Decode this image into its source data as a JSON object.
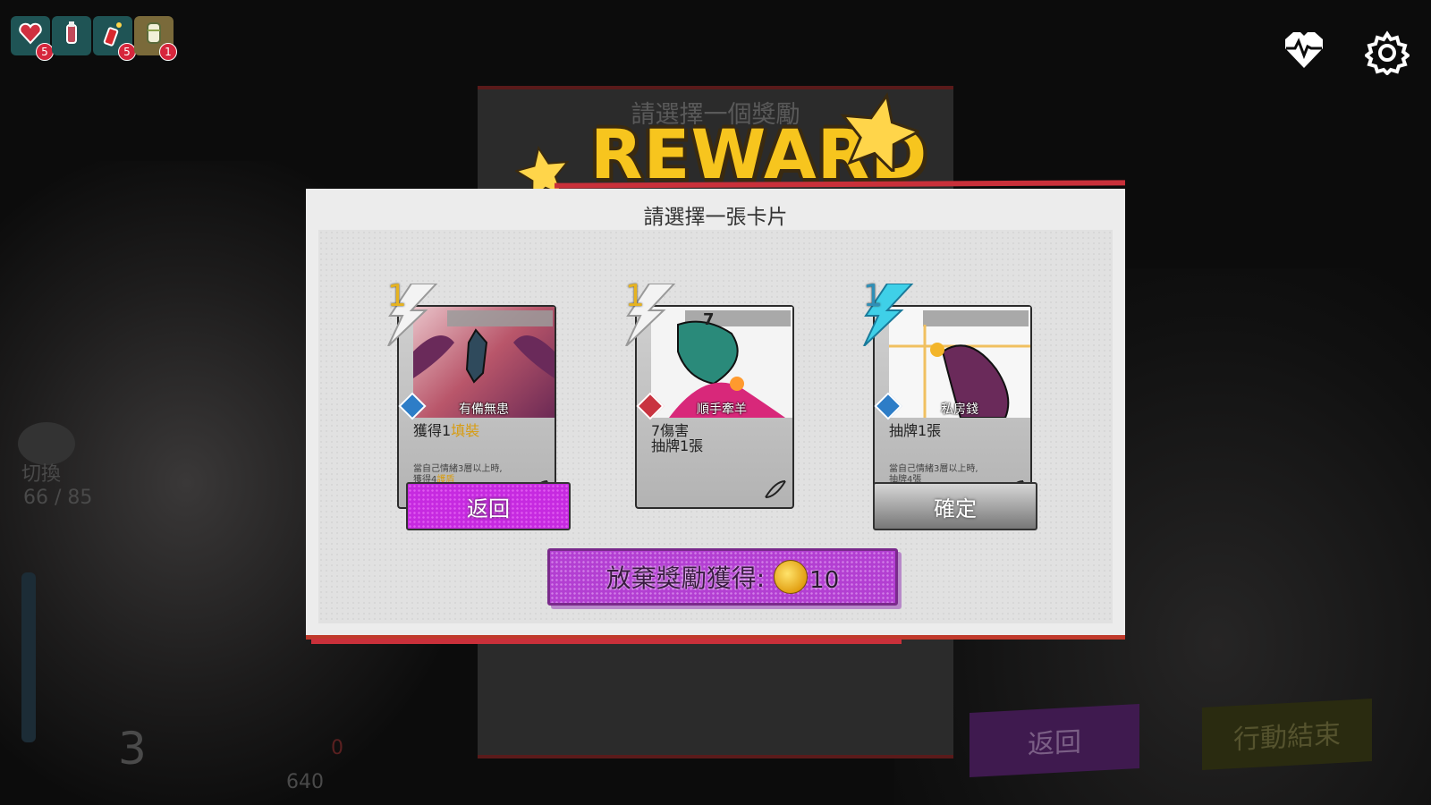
{
  "background": {
    "panel_title": "請選擇一個獎勵",
    "switch_label": "切換",
    "hp_text": "66 / 85",
    "energy_value": "3",
    "bottom_value_1": "0",
    "bottom_value_2": "640",
    "back_label": "返回",
    "end_turn_label": "行動結束"
  },
  "items": [
    {
      "icon": "heart-potion-icon",
      "badge": "5"
    },
    {
      "icon": "bottle-icon",
      "badge": ""
    },
    {
      "icon": "firecracker-icon",
      "badge": "5"
    },
    {
      "icon": "bandage-icon",
      "badge": "1"
    }
  ],
  "top_right": {
    "heart_icon": "heartbeat-icon",
    "settings_icon": "gear-icon"
  },
  "reward": {
    "title": "REWARD"
  },
  "dialog": {
    "title": "請選擇一張卡片",
    "cards": [
      {
        "cost": "1",
        "name": "有備無患",
        "type_color": "blue",
        "desc_prefix": "獲得1",
        "desc_highlight": "填裝",
        "small_line1": "當自己情緒3層以上時,",
        "small_line2_prefix": "獲得4",
        "small_line2_highlight": "護盾"
      },
      {
        "cost": "1",
        "name": "順手牽羊",
        "type_color": "red",
        "damage": "7",
        "desc_line1": "7傷害",
        "desc_line2": "抽牌1張"
      },
      {
        "cost": "1",
        "name": "私房錢",
        "type_color": "blue",
        "desc_line1": "抽牌1張",
        "small_line1": "當自己情緒3層以上時,",
        "small_line2": "抽牌4張"
      }
    ],
    "back_button": "返回",
    "confirm_button": "確定",
    "skip_button": "放棄獎勵獲得:",
    "skip_amount": "10"
  }
}
